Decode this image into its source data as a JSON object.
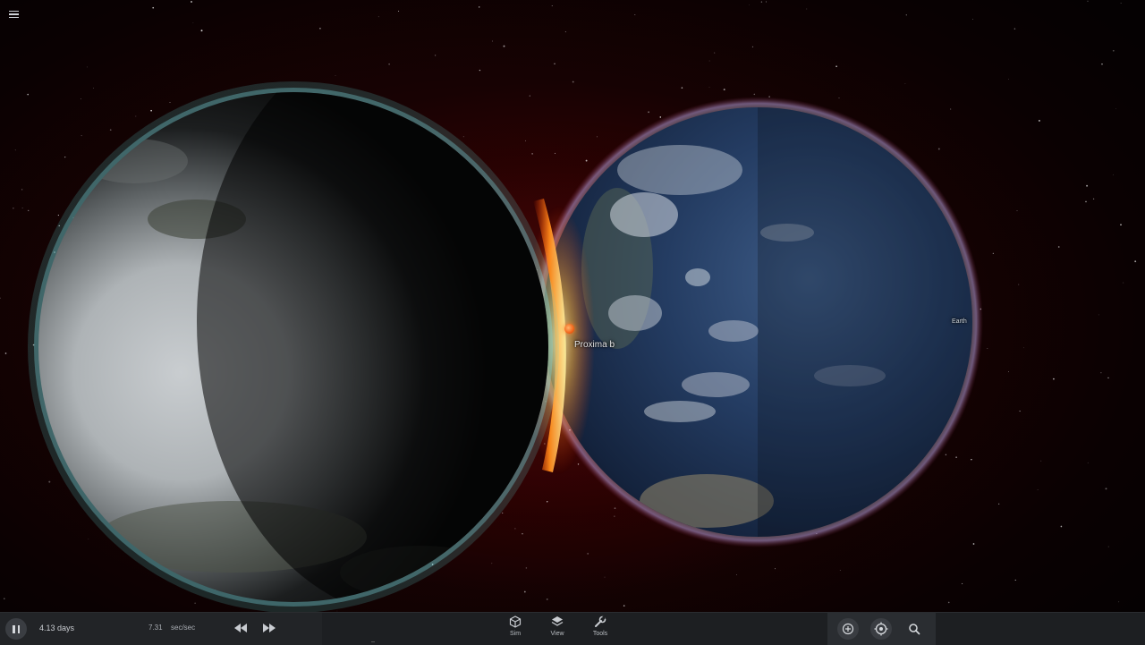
{
  "app": {
    "menu_icon": "hamburger-menu-icon"
  },
  "scene": {
    "labels": {
      "proxima": "Proxima b",
      "earth": "Earth"
    },
    "colors": {
      "space_background": "#1a0203",
      "proxima_marker": "#f2661a",
      "atmosphere_glow": "#5fe0d8"
    }
  },
  "toolbar": {
    "pause_icon": "pause-icon",
    "time_display": "4.13 days",
    "speed_value": "7.31",
    "speed_unit": "sec/sec",
    "rewind_icon": "rewind-icon",
    "fast_forward_icon": "fast-forward-icon",
    "nav": [
      {
        "label": "Sim",
        "icon": "cube-icon"
      },
      {
        "label": "View",
        "icon": "layers-icon"
      },
      {
        "label": "Tools",
        "icon": "wrench-icon"
      }
    ],
    "right_buttons": [
      {
        "icon": "add-circle-icon"
      },
      {
        "icon": "center-target-icon"
      },
      {
        "icon": "search-icon"
      }
    ]
  }
}
